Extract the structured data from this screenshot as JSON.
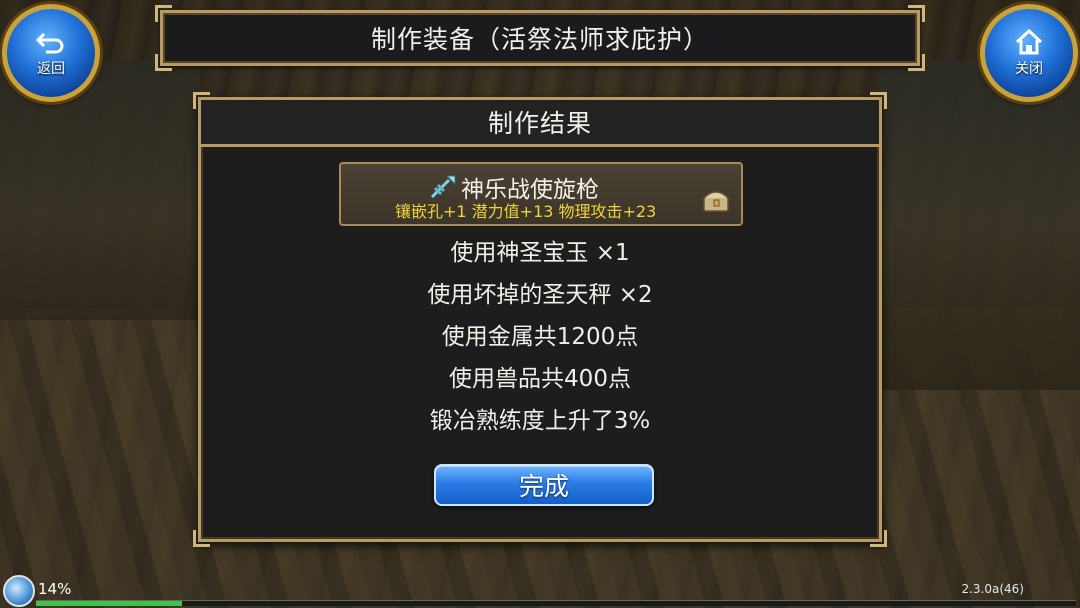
{
  "nav": {
    "back_label": "返回",
    "close_label": "关闭"
  },
  "header": {
    "title": "制作装备（活祭法师求庇护）"
  },
  "dialog": {
    "title": "制作结果",
    "item": {
      "name": "神乐战使旋枪",
      "icon": "spear-icon",
      "stats": "镶嵌孔+1 潜力值+13 物理攻击+23"
    },
    "usage": [
      "使用神圣宝玉 ×1",
      "使用坏掉的圣天秤 ×2",
      "使用金属共1200点",
      "使用兽品共400点",
      "锻冶熟练度上升了3%"
    ],
    "done_label": "完成"
  },
  "status": {
    "percent": "14%",
    "progress": 0.14,
    "version": "2.3.0a(46)"
  },
  "colors": {
    "accent_blue": "#2b7de6",
    "stat_yellow": "#f2d23a",
    "frame_gold": "#b89a66"
  }
}
